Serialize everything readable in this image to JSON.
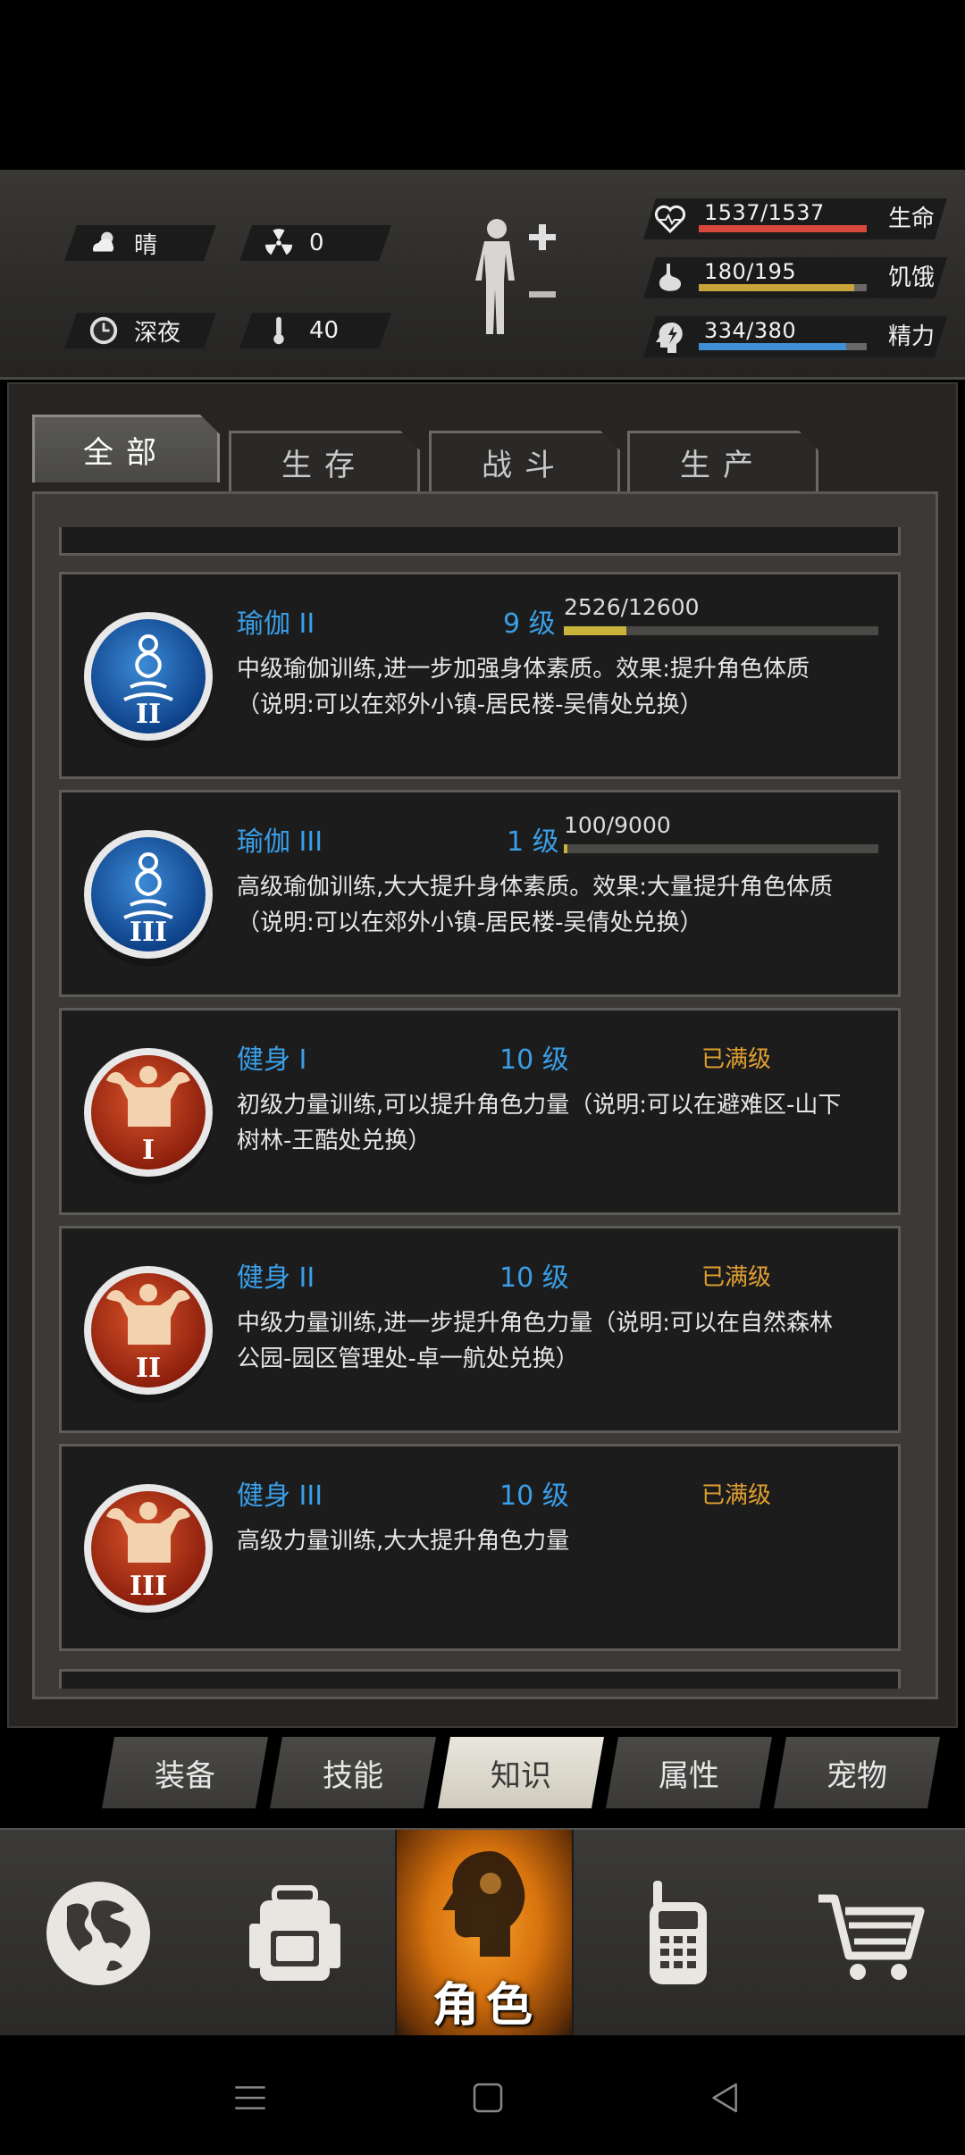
{
  "environment": {
    "weather": "晴",
    "radiation": "0",
    "time_of_day": "深夜",
    "temperature": "40"
  },
  "stats": {
    "life": {
      "label": "生命",
      "value": "1537/1537",
      "fraction": 1.0,
      "color": "#d9483b"
    },
    "hunger": {
      "label": "饥饿",
      "value": "180/195",
      "fraction": 0.923,
      "color": "#c9a43b"
    },
    "energy": {
      "label": "精力",
      "value": "334/380",
      "fraction": 0.879,
      "color": "#3f8fd6"
    }
  },
  "tabs": [
    {
      "label": "全部",
      "active": true
    },
    {
      "label": "生存",
      "active": false
    },
    {
      "label": "战斗",
      "active": false
    },
    {
      "label": "生产",
      "active": false
    }
  ],
  "skills": [
    {
      "name": "瑜伽 II",
      "level": "9 级",
      "exp": "2526/12600",
      "exp_fraction": 0.2,
      "max_label": "",
      "description": "中级瑜伽训练,进一步加强身体素质。效果:提升角色体质（说明:可以在郊外小镇-居民楼-吴倩处兑换）",
      "icon": "yoga-icon",
      "numeral": "II"
    },
    {
      "name": "瑜伽 III",
      "level": "1 级",
      "exp": "100/9000",
      "exp_fraction": 0.011,
      "max_label": "",
      "description": "高级瑜伽训练,大大提升身体素质。效果:大量提升角色体质（说明:可以在郊外小镇-居民楼-吴倩处兑换）",
      "icon": "yoga-icon",
      "numeral": "III"
    },
    {
      "name": "健身 I",
      "level": "10 级",
      "exp": "",
      "max_label": "已满级",
      "description": "初级力量训练,可以提升角色力量（说明:可以在避难区-山下树林-王酷处兑换）",
      "icon": "muscle-icon",
      "numeral": "I"
    },
    {
      "name": "健身 II",
      "level": "10 级",
      "exp": "",
      "max_label": "已满级",
      "description": "中级力量训练,进一步提升角色力量（说明:可以在自然森林公园-园区管理处-卓一航处兑换）",
      "icon": "muscle-icon",
      "numeral": "II"
    },
    {
      "name": "健身 III",
      "level": "10 级",
      "exp": "",
      "max_label": "已满级",
      "description": "高级力量训练,大大提升角色力量",
      "icon": "muscle-icon",
      "numeral": "III"
    }
  ],
  "subnav": [
    {
      "label": "装备",
      "active": false
    },
    {
      "label": "技能",
      "active": false
    },
    {
      "label": "知识",
      "active": true
    },
    {
      "label": "属性",
      "active": false
    },
    {
      "label": "宠物",
      "active": false
    }
  ],
  "bottom_nav": {
    "world": "globe-icon",
    "bag": "backpack-icon",
    "role_label": "角色",
    "radio": "radio-icon",
    "cart": "cart-icon"
  }
}
